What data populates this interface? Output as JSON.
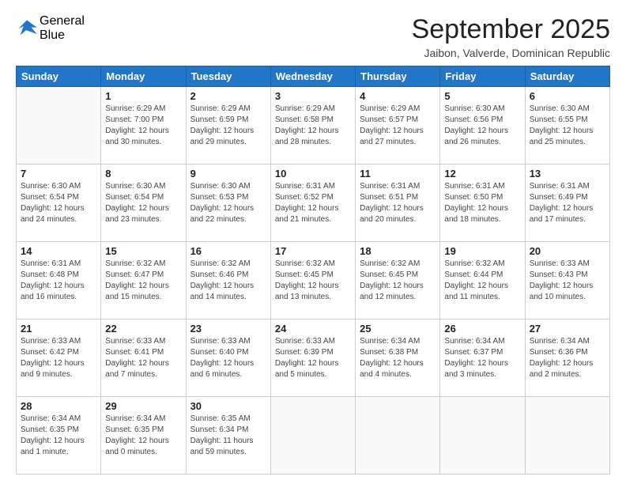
{
  "header": {
    "logo_general": "General",
    "logo_blue": "Blue",
    "month": "September 2025",
    "location": "Jaibon, Valverde, Dominican Republic"
  },
  "days_of_week": [
    "Sunday",
    "Monday",
    "Tuesday",
    "Wednesday",
    "Thursday",
    "Friday",
    "Saturday"
  ],
  "weeks": [
    [
      {
        "day": "",
        "info": ""
      },
      {
        "day": "1",
        "info": "Sunrise: 6:29 AM\nSunset: 7:00 PM\nDaylight: 12 hours\nand 30 minutes."
      },
      {
        "day": "2",
        "info": "Sunrise: 6:29 AM\nSunset: 6:59 PM\nDaylight: 12 hours\nand 29 minutes."
      },
      {
        "day": "3",
        "info": "Sunrise: 6:29 AM\nSunset: 6:58 PM\nDaylight: 12 hours\nand 28 minutes."
      },
      {
        "day": "4",
        "info": "Sunrise: 6:29 AM\nSunset: 6:57 PM\nDaylight: 12 hours\nand 27 minutes."
      },
      {
        "day": "5",
        "info": "Sunrise: 6:30 AM\nSunset: 6:56 PM\nDaylight: 12 hours\nand 26 minutes."
      },
      {
        "day": "6",
        "info": "Sunrise: 6:30 AM\nSunset: 6:55 PM\nDaylight: 12 hours\nand 25 minutes."
      }
    ],
    [
      {
        "day": "7",
        "info": "Sunrise: 6:30 AM\nSunset: 6:54 PM\nDaylight: 12 hours\nand 24 minutes."
      },
      {
        "day": "8",
        "info": "Sunrise: 6:30 AM\nSunset: 6:54 PM\nDaylight: 12 hours\nand 23 minutes."
      },
      {
        "day": "9",
        "info": "Sunrise: 6:30 AM\nSunset: 6:53 PM\nDaylight: 12 hours\nand 22 minutes."
      },
      {
        "day": "10",
        "info": "Sunrise: 6:31 AM\nSunset: 6:52 PM\nDaylight: 12 hours\nand 21 minutes."
      },
      {
        "day": "11",
        "info": "Sunrise: 6:31 AM\nSunset: 6:51 PM\nDaylight: 12 hours\nand 20 minutes."
      },
      {
        "day": "12",
        "info": "Sunrise: 6:31 AM\nSunset: 6:50 PM\nDaylight: 12 hours\nand 18 minutes."
      },
      {
        "day": "13",
        "info": "Sunrise: 6:31 AM\nSunset: 6:49 PM\nDaylight: 12 hours\nand 17 minutes."
      }
    ],
    [
      {
        "day": "14",
        "info": "Sunrise: 6:31 AM\nSunset: 6:48 PM\nDaylight: 12 hours\nand 16 minutes."
      },
      {
        "day": "15",
        "info": "Sunrise: 6:32 AM\nSunset: 6:47 PM\nDaylight: 12 hours\nand 15 minutes."
      },
      {
        "day": "16",
        "info": "Sunrise: 6:32 AM\nSunset: 6:46 PM\nDaylight: 12 hours\nand 14 minutes."
      },
      {
        "day": "17",
        "info": "Sunrise: 6:32 AM\nSunset: 6:45 PM\nDaylight: 12 hours\nand 13 minutes."
      },
      {
        "day": "18",
        "info": "Sunrise: 6:32 AM\nSunset: 6:45 PM\nDaylight: 12 hours\nand 12 minutes."
      },
      {
        "day": "19",
        "info": "Sunrise: 6:32 AM\nSunset: 6:44 PM\nDaylight: 12 hours\nand 11 minutes."
      },
      {
        "day": "20",
        "info": "Sunrise: 6:33 AM\nSunset: 6:43 PM\nDaylight: 12 hours\nand 10 minutes."
      }
    ],
    [
      {
        "day": "21",
        "info": "Sunrise: 6:33 AM\nSunset: 6:42 PM\nDaylight: 12 hours\nand 9 minutes."
      },
      {
        "day": "22",
        "info": "Sunrise: 6:33 AM\nSunset: 6:41 PM\nDaylight: 12 hours\nand 7 minutes."
      },
      {
        "day": "23",
        "info": "Sunrise: 6:33 AM\nSunset: 6:40 PM\nDaylight: 12 hours\nand 6 minutes."
      },
      {
        "day": "24",
        "info": "Sunrise: 6:33 AM\nSunset: 6:39 PM\nDaylight: 12 hours\nand 5 minutes."
      },
      {
        "day": "25",
        "info": "Sunrise: 6:34 AM\nSunset: 6:38 PM\nDaylight: 12 hours\nand 4 minutes."
      },
      {
        "day": "26",
        "info": "Sunrise: 6:34 AM\nSunset: 6:37 PM\nDaylight: 12 hours\nand 3 minutes."
      },
      {
        "day": "27",
        "info": "Sunrise: 6:34 AM\nSunset: 6:36 PM\nDaylight: 12 hours\nand 2 minutes."
      }
    ],
    [
      {
        "day": "28",
        "info": "Sunrise: 6:34 AM\nSunset: 6:35 PM\nDaylight: 12 hours\nand 1 minute."
      },
      {
        "day": "29",
        "info": "Sunrise: 6:34 AM\nSunset: 6:35 PM\nDaylight: 12 hours\nand 0 minutes."
      },
      {
        "day": "30",
        "info": "Sunrise: 6:35 AM\nSunset: 6:34 PM\nDaylight: 11 hours\nand 59 minutes."
      },
      {
        "day": "",
        "info": ""
      },
      {
        "day": "",
        "info": ""
      },
      {
        "day": "",
        "info": ""
      },
      {
        "day": "",
        "info": ""
      }
    ]
  ]
}
